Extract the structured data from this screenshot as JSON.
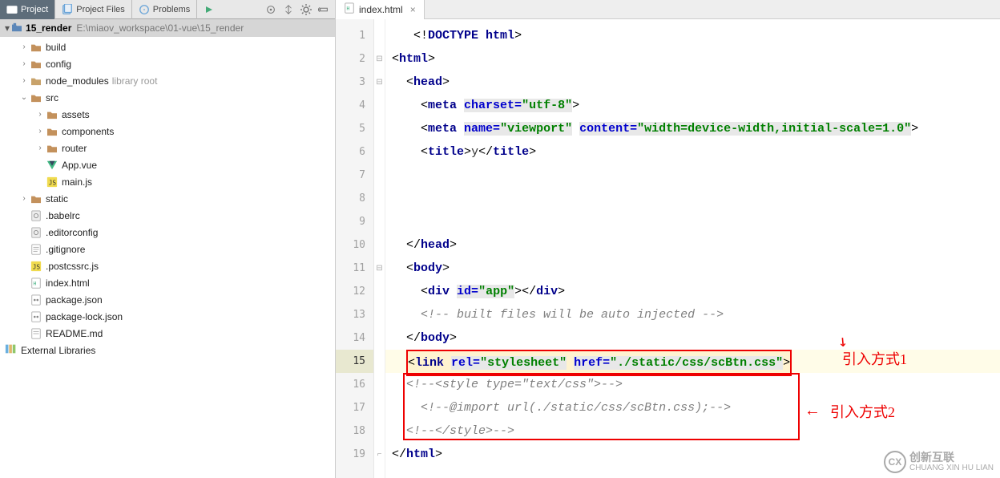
{
  "tabs": {
    "project": "Project",
    "project_files": "Project Files",
    "problems": "Problems"
  },
  "project": {
    "name": "15_render",
    "path": "E:\\miaov_workspace\\01-vue\\15_render"
  },
  "tree": {
    "build": "build",
    "config": "config",
    "node_modules": "node_modules",
    "node_modules_hint": "library root",
    "src": "src",
    "assets": "assets",
    "components": "components",
    "router": "router",
    "app_vue": "App.vue",
    "main_js": "main.js",
    "static": "static",
    "babelrc": ".babelrc",
    "editorconfig": ".editorconfig",
    "gitignore": ".gitignore",
    "postcssrc": ".postcssrc.js",
    "index_html": "index.html",
    "package_json": "package.json",
    "package_lock": "package-lock.json",
    "readme": "README.md",
    "external": "External Libraries"
  },
  "editor_tab": "index.html",
  "code": {
    "l1": "<!DOCTYPE html>",
    "l2_open": "<html>",
    "l3_open": "<head>",
    "l4_meta": "<meta charset=\"utf-8\">",
    "l5_meta": "<meta name=\"viewport\" content=\"width=device-width,initial-scale=1.0\">",
    "l6_title": "<title>y</title>",
    "l10_close_head": "</head>",
    "l11_body": "<body>",
    "l12_div": "<div id=\"app\"></div>",
    "l13_comment": "<!-- built files will be auto injected -->",
    "l14_close_body": "</body>",
    "l15_link": "<link rel=\"stylesheet\" href=\"./static/css/scBtn.css\">",
    "l16_c": "<!--<style type=\"text/css\">-->",
    "l17_c": "<!--@import url(./static/css/scBtn.css);-->",
    "l18_c": "<!--</style>-->",
    "l19_close_html": "</html>"
  },
  "annotations": {
    "method1": "引入方式1",
    "method2": "引入方式2"
  },
  "watermark": {
    "big": "创新互联",
    "small": "CHUANG XIN HU LIAN"
  },
  "line_numbers": [
    "1",
    "2",
    "3",
    "4",
    "5",
    "6",
    "7",
    "8",
    "9",
    "10",
    "11",
    "12",
    "13",
    "14",
    "15",
    "16",
    "17",
    "18",
    "19"
  ]
}
